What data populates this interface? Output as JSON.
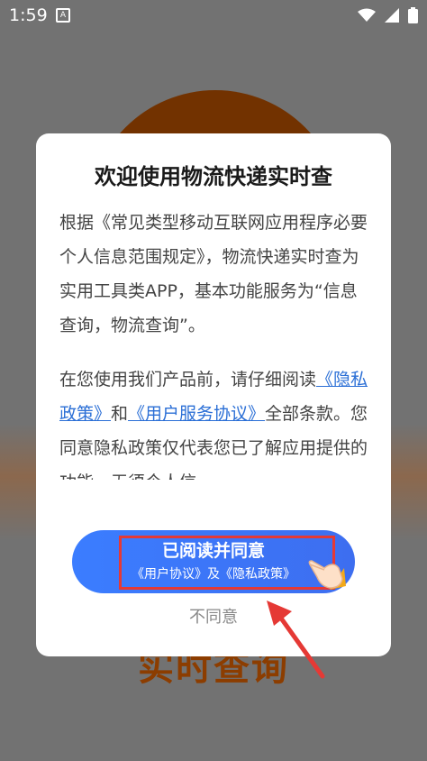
{
  "status_bar": {
    "time": "1:59",
    "notification_glyph": "A",
    "icons": [
      "wifi-icon",
      "signal-icon",
      "battery-icon"
    ]
  },
  "background": {
    "title": "实时查询"
  },
  "dialog": {
    "title": "欢迎使用物流快递实时查",
    "paragraph1": "根据《常见类型移动互联网应用程序必要个人信息范围规定》，物流快递实时查为实用工具类APP，基本功能服务为“信息查询，物流查询”。",
    "paragraph2_prefix": "在您使用我们产品前，请仔细阅读",
    "privacy_link": "《隐私政策》",
    "conjunction": "和",
    "service_link": "《用户服务协议》",
    "paragraph2_suffix": "全部条款。您同意隐私政策仅代表您已了解应用提供的功能，无须个人信",
    "agree_button": {
      "main": "已阅读并同意",
      "sub": "《用户协议》及《隐私政策》"
    },
    "disagree_label": "不同意"
  },
  "colors": {
    "accent": "#3b7dff",
    "link": "#2b6fd6",
    "highlight": "#e53935",
    "overlay": "#727272"
  }
}
